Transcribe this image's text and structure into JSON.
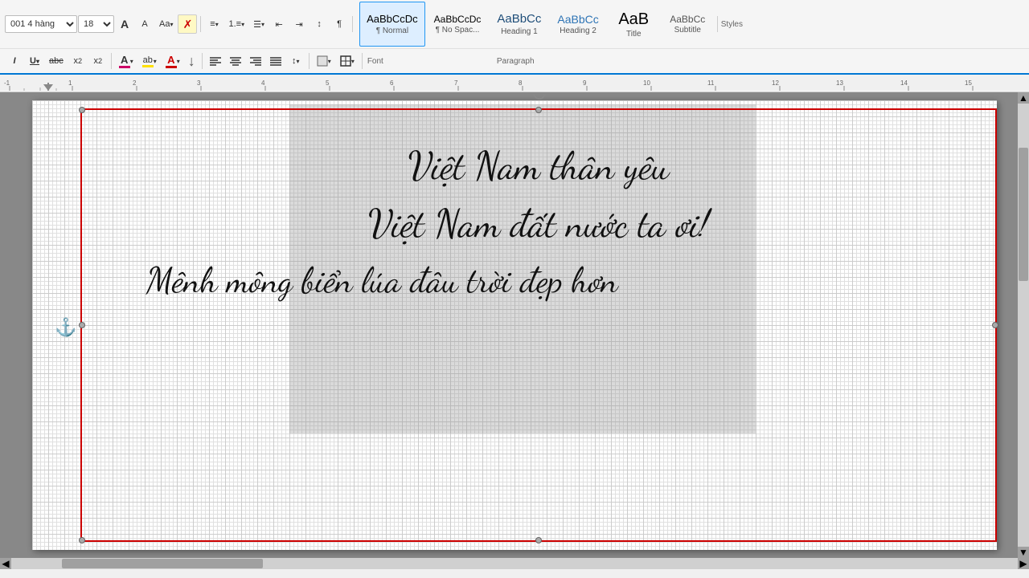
{
  "toolbar": {
    "font_name": "001 4 hàng",
    "font_size": "18",
    "styles_label": "Styles",
    "font_label": "Font",
    "paragraph_label": "Paragraph",
    "style_items": [
      {
        "id": "normal",
        "preview": "AaBbCcDc",
        "label": "¶ Normal",
        "selected": true
      },
      {
        "id": "no-space",
        "preview": "AaBbCcDc",
        "label": "¶ No Spac...",
        "selected": false
      },
      {
        "id": "heading1",
        "preview": "AaBbCc",
        "label": "Heading 1",
        "selected": false
      },
      {
        "id": "heading2",
        "preview": "AaBbCc",
        "label": "Heading 2",
        "selected": false
      },
      {
        "id": "title",
        "preview": "AaB",
        "label": "Title",
        "selected": false
      },
      {
        "id": "subtitle",
        "preview": "AaBbCc",
        "label": "Subtitle",
        "selected": false
      }
    ]
  },
  "poem": {
    "line1": "Việt Nam thân yêu",
    "line2": "Việt Nam đất nước ta ơi!",
    "line3": "Mênh mông biển lúa đâu trời đẹp hơn"
  },
  "ruler": {
    "unit": "inches",
    "ticks": [
      "-1",
      "1",
      "2",
      "3",
      "4",
      "5",
      "6",
      "7",
      "8",
      "9",
      "10",
      "11",
      "12",
      "13",
      "14",
      "15"
    ]
  },
  "icons": {
    "grow_font": "A",
    "shrink_font": "A",
    "change_case": "Aa",
    "clear_format": "✗",
    "bullets": "≡",
    "numbering": "1.",
    "multilevel": "☰",
    "decrease_indent": "←",
    "increase_indent": "→",
    "sort": "↕",
    "show_para": "¶",
    "align_left": "≡",
    "align_center": "≡",
    "align_right": "≡",
    "justify": "≡",
    "line_spacing": "↕",
    "shading": "◻",
    "borders": "⊞",
    "italic": "I",
    "underline": "U",
    "strikethrough": "abc",
    "subscript": "x₂",
    "superscript": "x²",
    "font_color_text": "A",
    "highlight": "ab",
    "font_color": "A",
    "anchor": "⚓",
    "rotate": "↺"
  }
}
